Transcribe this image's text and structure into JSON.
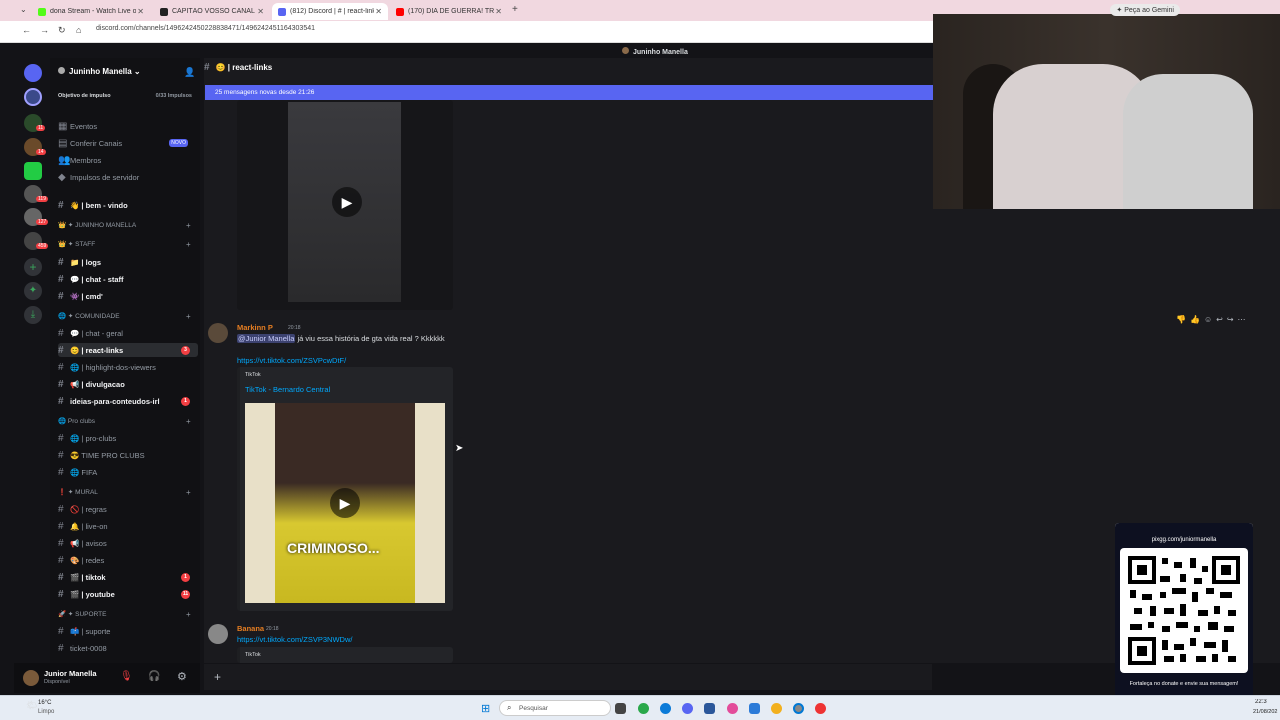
{
  "browser": {
    "tabs": [
      {
        "label": "dona Stream - Watch Live on Ki",
        "color": "#53fc18"
      },
      {
        "label": "CAPITÃO VOSSO CANAL",
        "color": "#222222"
      },
      {
        "label": "(812) Discord | # | react-links",
        "color": "#5865f2"
      },
      {
        "label": "(170) DIA DE GUERRA! TRAIRA",
        "color": "#ff0000"
      }
    ],
    "url": "discord.com/channels/1496242450228838471/1496242451164303541",
    "gemini": "Peça ao Gemini"
  },
  "discord": {
    "top_user": "Juninho Manella",
    "server_name": "Juninho Manella",
    "boost_goal": "Objetivo de impulso",
    "boost_count": "0/33 Impulsos",
    "server_badges": [
      "11",
      "14",
      "119",
      "127",
      "459"
    ],
    "nav": [
      "Eventos",
      "Conferir Canais",
      "Membros",
      "Impulsos de servidor"
    ],
    "novo": "NOVO",
    "channels": [
      {
        "type": "chan",
        "label": "👋 | bem - vindo",
        "bold": true
      },
      {
        "type": "cat",
        "label": "👑 ✦ JUNINHO MANELLA"
      },
      {
        "type": "cat",
        "label": "👑 ✦ STAFF"
      },
      {
        "type": "chan",
        "label": "📁 | logs",
        "bold": true
      },
      {
        "type": "chan",
        "label": "💬 | chat - staff",
        "bold": true
      },
      {
        "type": "chan",
        "label": "👾 | cmd'",
        "bold": true
      },
      {
        "type": "cat",
        "label": "🌐 ✦ COMUNIDADE"
      },
      {
        "type": "chan",
        "label": "💬 | chat - geral"
      },
      {
        "type": "chan",
        "label": "😊 | react-links",
        "bold": true,
        "active": true,
        "badge": "3"
      },
      {
        "type": "chan",
        "label": "🌐 | highlight-dos-viewers"
      },
      {
        "type": "chan",
        "label": "📢 | divulgacao",
        "bold": true
      },
      {
        "type": "chan",
        "label": "ideias-para-conteudos-irl",
        "bold": true,
        "badge": "1"
      },
      {
        "type": "cat",
        "label": "🌐 Pro clubs"
      },
      {
        "type": "chan",
        "label": "🌐 | pro-clubs"
      },
      {
        "type": "chan",
        "label": "😎 TIME PRO CLUBS"
      },
      {
        "type": "chan",
        "label": "🌐 FIFA"
      },
      {
        "type": "cat",
        "label": "❗ ✦ MURAL"
      },
      {
        "type": "chan",
        "label": "🚫 | regras"
      },
      {
        "type": "chan",
        "label": "🔔 | live-on"
      },
      {
        "type": "chan",
        "label": "📢 | avisos"
      },
      {
        "type": "chan",
        "label": "🎨 | redes"
      },
      {
        "type": "chan",
        "label": "🎬 | tiktok",
        "bold": true,
        "badge": "1"
      },
      {
        "type": "chan",
        "label": "🎬 | youtube",
        "bold": true,
        "badge": "11"
      },
      {
        "type": "cat",
        "label": "🚀 ✦ SUPORTE"
      },
      {
        "type": "chan",
        "label": "📫 | suporte"
      },
      {
        "type": "chan",
        "label": "ticket-0008"
      }
    ],
    "user": {
      "name": "Junior Manella",
      "status": "Disponível"
    },
    "channel_header": "😊 | react-links",
    "new_messages": "25 mensagens novas desde 21:26",
    "messages": [
      {
        "author": "Markinn P",
        "author_color": "#e67e22",
        "time": "20:18",
        "mention": "@Junior Manella",
        "text": " já viu essa história de gta vida real ? Kkkkkk",
        "link": "https://vt.tiktok.com/ZSVPcwDtF/",
        "provider": "TikTok",
        "embed_title": "TikTok - Bernardo Central",
        "video_caption": "CRIMINOSO..."
      },
      {
        "author": "Banana",
        "author_color": "#e67e22",
        "time": "20:18",
        "link": "https://vt.tiktok.com/ZSVP3NWDw/",
        "provider": "TikTok"
      }
    ]
  },
  "qr": {
    "url": "pixgg.com/juniormanella",
    "caption": "Fortaleça no donate e envie sua mensagem!"
  },
  "taskbar": {
    "weather_temp": "16°C",
    "weather_label": "Limpo",
    "search": "Pesquisar",
    "time": "22:3",
    "date": "21/08/202"
  }
}
